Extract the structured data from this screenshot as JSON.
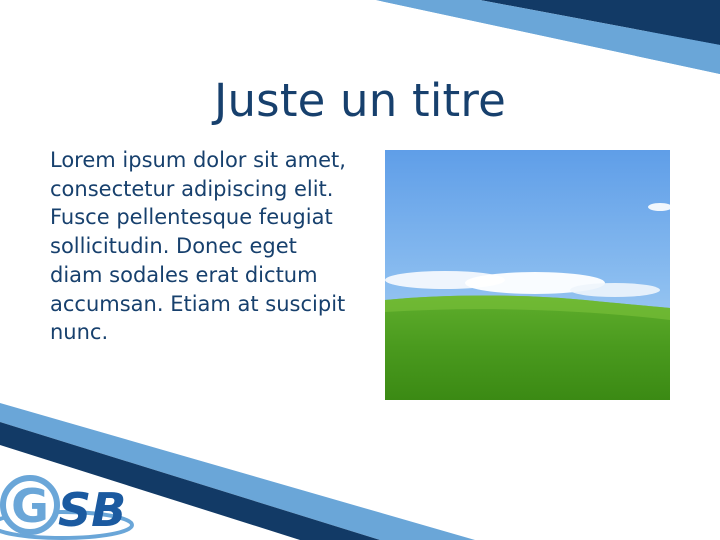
{
  "slide": {
    "title": "Juste un titre",
    "body": "Lorem ipsum dolor sit amet, consectetur adipiscing elit. Fusce pellentesque feugiat sollicitudin. Donec eget diam sodales erat dictum accumsan. Etiam at suscipit nunc."
  },
  "logo": {
    "text": "GSB",
    "letter_g": "G",
    "letters_sb": "SB"
  },
  "colors": {
    "title": "#17406d",
    "body": "#17406d",
    "band_dark": "#123a66",
    "band_light": "#6aa6d8",
    "logo_blue": "#1b5aa0",
    "logo_light": "#6aa6d8"
  },
  "image": {
    "subject": "green-hill-blue-sky-photo"
  }
}
